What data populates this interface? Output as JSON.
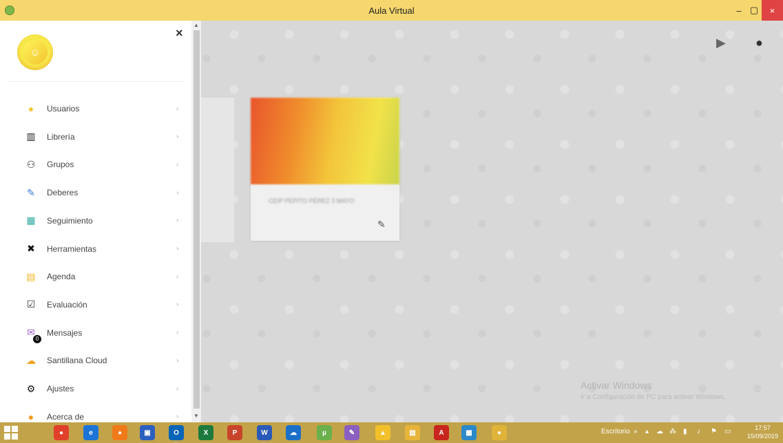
{
  "window": {
    "title": "Aula Virtual",
    "controls": {
      "minimize": "–",
      "maximize": "▢",
      "close": "×"
    }
  },
  "sidebar": {
    "close_label": "×",
    "items": [
      {
        "label": "Usuarios",
        "icon": "user-circle-icon",
        "icon_glyph": "●",
        "icon_color": "#f2c93a"
      },
      {
        "label": "Librería",
        "icon": "books-icon",
        "icon_glyph": "▥",
        "icon_color": "#222"
      },
      {
        "label": "Grupos",
        "icon": "group-icon",
        "icon_glyph": "⚇",
        "icon_color": "#222"
      },
      {
        "label": "Deberes",
        "icon": "pencil-icon",
        "icon_glyph": "✎",
        "icon_color": "#3a7bd5"
      },
      {
        "label": "Seguimiento",
        "icon": "chart-calendar-icon",
        "icon_glyph": "▦",
        "icon_color": "#2ba8a0"
      },
      {
        "label": "Herramientas",
        "icon": "tools-icon",
        "icon_glyph": "✖",
        "icon_color": "#111"
      },
      {
        "label": "Agenda",
        "icon": "agenda-icon",
        "icon_glyph": "▤",
        "icon_color": "#f2b51e"
      },
      {
        "label": "Evaluación",
        "icon": "clipboard-icon",
        "icon_glyph": "☑",
        "icon_color": "#333"
      },
      {
        "label": "Mensajes",
        "icon": "envelope-icon",
        "icon_glyph": "✉",
        "icon_color": "#a062c9",
        "badge": "0"
      },
      {
        "label": "Santillana Cloud",
        "icon": "cloud-upload-icon",
        "icon_glyph": "☁",
        "icon_color": "#f2a21e"
      },
      {
        "label": "Ajustes",
        "icon": "gear-icon",
        "icon_glyph": "⚙",
        "icon_color": "#111"
      },
      {
        "label": "Acerca de",
        "icon": "info-circle-icon",
        "icon_glyph": "●",
        "icon_color": "#f29f1e"
      }
    ],
    "chevron": "›"
  },
  "card": {
    "text": "CEIP PEPITO PÉREZ 3 MAYO",
    "edit_icon": "✎"
  },
  "top_actions": {
    "play_icon": "▶",
    "user_icon": "●"
  },
  "watermark": {
    "line1": "Activar Windows",
    "line2": "Ir a Configuración de PC para activar Windows."
  },
  "taskbar": {
    "desktop_label": "Escritorio",
    "time": "17:57",
    "date": "15/09/2019",
    "apps": [
      {
        "name": "chrome-icon",
        "glyph": "●",
        "color": "#e0402a"
      },
      {
        "name": "ie-icon",
        "glyph": "e",
        "color": "#1c74d6"
      },
      {
        "name": "firefox-icon",
        "glyph": "●",
        "color": "#f07a1a"
      },
      {
        "name": "media-icon",
        "glyph": "▣",
        "color": "#2b5fbf"
      },
      {
        "name": "outlook-icon",
        "glyph": "O",
        "color": "#0a64b5"
      },
      {
        "name": "excel-icon",
        "glyph": "X",
        "color": "#1d7a3e"
      },
      {
        "name": "powerpoint-icon",
        "glyph": "P",
        "color": "#c8442a"
      },
      {
        "name": "word-icon",
        "glyph": "W",
        "color": "#2a5ab7"
      },
      {
        "name": "onedrive-icon",
        "glyph": "☁",
        "color": "#1a70c9"
      },
      {
        "name": "utorrent-icon",
        "glyph": "µ",
        "color": "#6ab04c"
      },
      {
        "name": "paint-icon",
        "glyph": "✎",
        "color": "#8a5fbf"
      },
      {
        "name": "drive-icon",
        "glyph": "▲",
        "color": "#f2c02a"
      },
      {
        "name": "folder-icon",
        "glyph": "▤",
        "color": "#e8b43a"
      },
      {
        "name": "acrobat-icon",
        "glyph": "A",
        "color": "#c8251e"
      },
      {
        "name": "app-grid-icon",
        "glyph": "▦",
        "color": "#2b89c9"
      },
      {
        "name": "chrome-active-icon",
        "glyph": "●",
        "color": "#e0b33a"
      }
    ]
  }
}
